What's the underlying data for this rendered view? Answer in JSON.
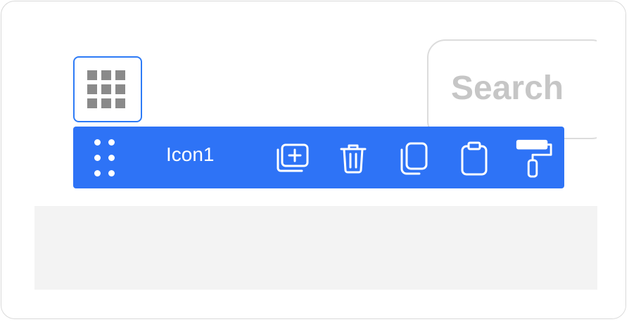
{
  "search": {
    "placeholder": "Search"
  },
  "selected_block": {
    "icon": "grid-icon"
  },
  "toolbar": {
    "label": "Icon1",
    "drag_icon": "drag-dots-icon",
    "buttons": [
      {
        "name": "add-layer-button",
        "icon": "add-layer-icon"
      },
      {
        "name": "delete-button",
        "icon": "trash-icon"
      },
      {
        "name": "duplicate-button",
        "icon": "copy-icon"
      },
      {
        "name": "paste-button",
        "icon": "clipboard-icon"
      },
      {
        "name": "style-button",
        "icon": "paint-roller-icon"
      }
    ]
  },
  "colors": {
    "accent": "#2e73f6",
    "selection_border": "#2e7bf6",
    "panel": "#f3f3f3",
    "placeholder_text": "#c6c6c6"
  }
}
